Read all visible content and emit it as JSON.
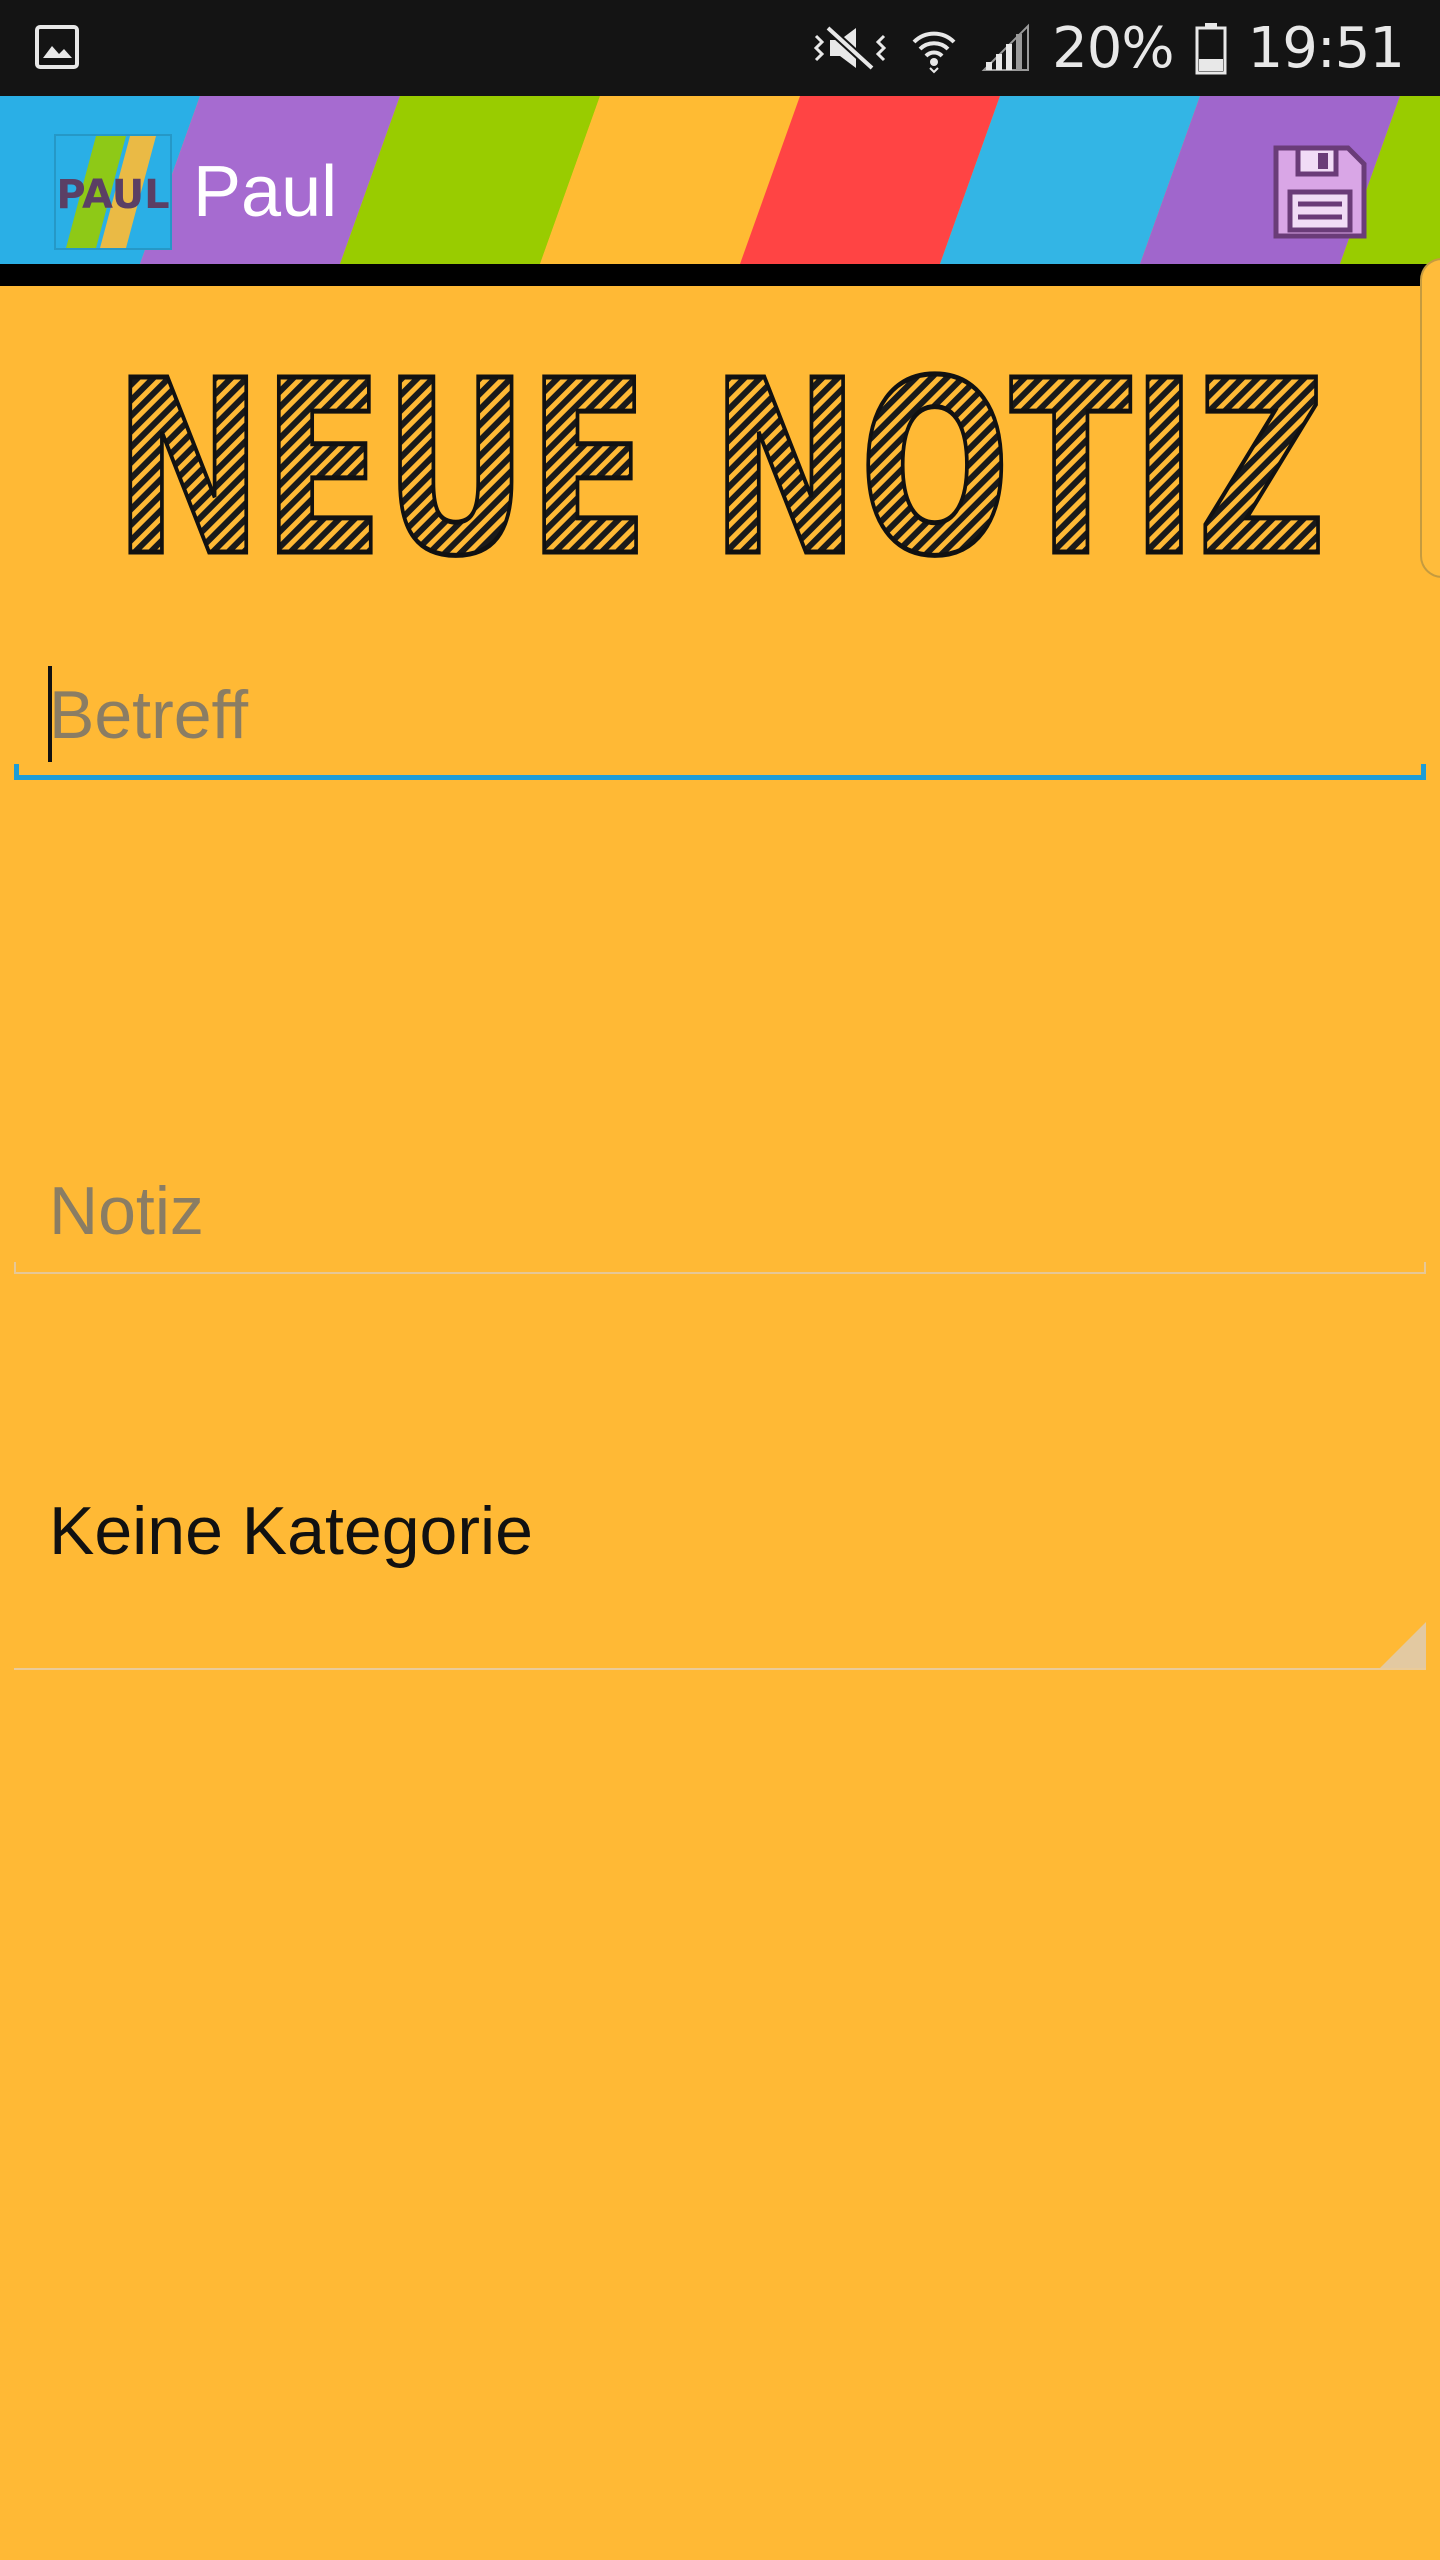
{
  "status_bar": {
    "battery_level": "20%",
    "time": "19:51",
    "icons": [
      "gallery-icon",
      "vibrate-icon",
      "wifi-icon",
      "signal-icon",
      "battery-icon"
    ]
  },
  "app_bar": {
    "logo_text": "PAUL",
    "title": "Paul",
    "stripe_colors": [
      "#2AAFE6",
      "#A66BD0",
      "#99CC00",
      "#FFBB33",
      "#FF4444",
      "#33B5E5",
      "#A066CC",
      "#99CC00"
    ],
    "save_icon": "save-icon"
  },
  "heading": {
    "text": "NEUE NOTIZ"
  },
  "form": {
    "subject_placeholder": "Betreff",
    "note_placeholder": "Notiz",
    "category_selected": "Keine Kategorie"
  },
  "colors": {
    "background": "#FFB935",
    "focus_accent": "#1E9DD8",
    "status_bar": "#141414"
  }
}
